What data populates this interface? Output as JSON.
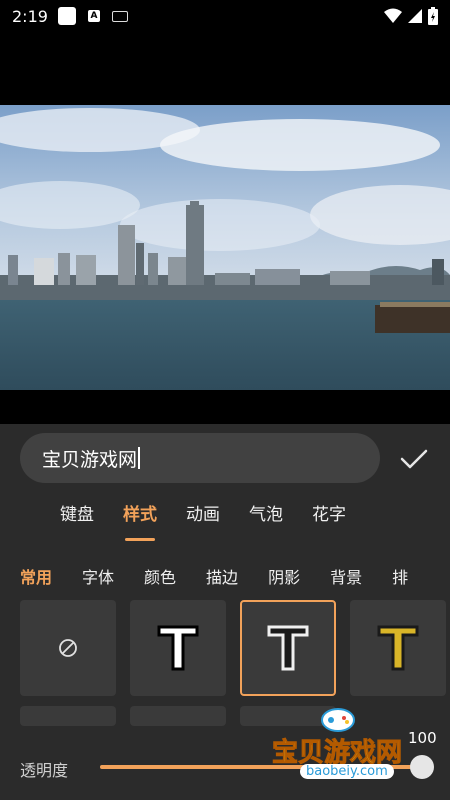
{
  "status_bar": {
    "time": "2:19",
    "letter": "A"
  },
  "text_input": {
    "value": "宝贝游戏网"
  },
  "main_tabs": [
    "键盘",
    "样式",
    "动画",
    "气泡",
    "花字"
  ],
  "sub_tabs": [
    "常用",
    "字体",
    "颜色",
    "描边",
    "阴影",
    "背景",
    "排"
  ],
  "style_cells": [
    {
      "icon": "no-style-icon"
    },
    {
      "glyph": "T",
      "style": "white-black-outline"
    },
    {
      "glyph": "T",
      "style": "white-dark-outline-selected"
    },
    {
      "glyph": "T",
      "style": "gold-outline"
    }
  ],
  "opacity": {
    "label": "透明度",
    "value": "100",
    "fraction": 1.0
  },
  "watermark": {
    "text": "宝贝游戏网",
    "url": "baobeiy.com"
  },
  "colors": {
    "accent": "#f2a25a",
    "panel": "#2b2b2b",
    "cell": "#3a3a3a"
  }
}
